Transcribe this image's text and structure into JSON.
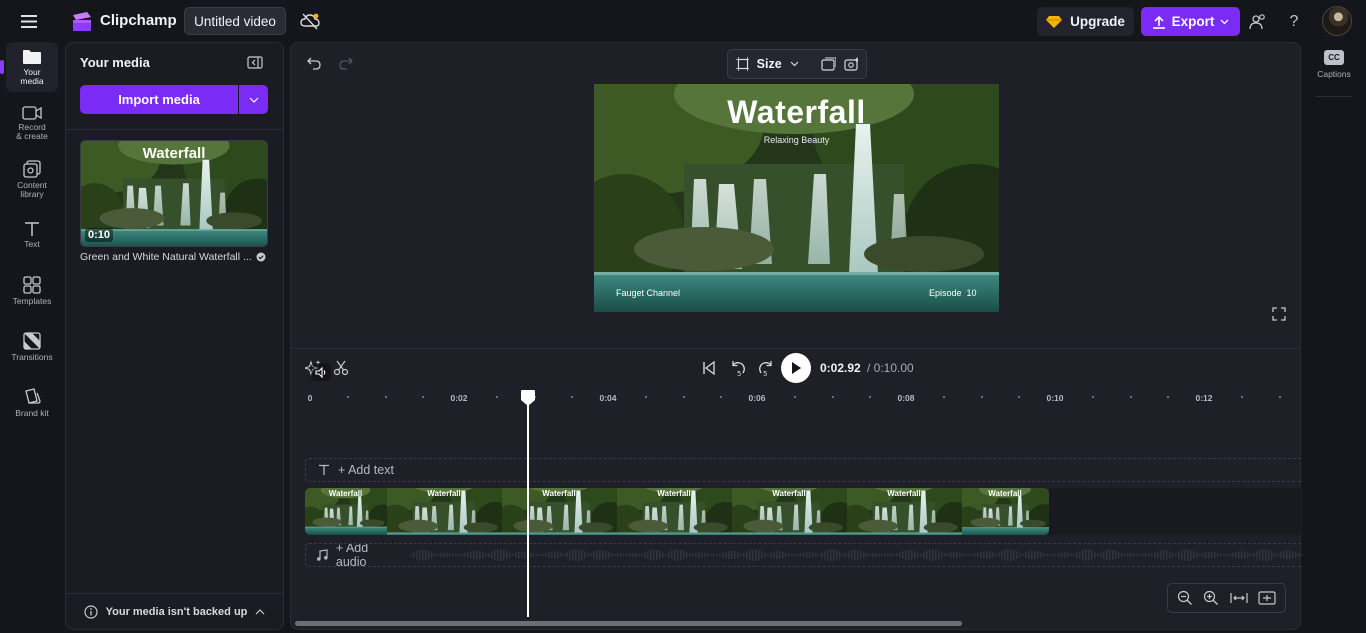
{
  "header": {
    "app_name": "Clipchamp",
    "project_title": "Untitled video",
    "upgrade_label": "Upgrade",
    "export_label": "Export",
    "help_label": "?",
    "accent_color": "#7a2bf5"
  },
  "rail": {
    "items": [
      {
        "label": "Your media",
        "icon": "folder-icon"
      },
      {
        "label": "Record & create",
        "icon": "camera-icon"
      },
      {
        "label": "Content library",
        "icon": "library-icon"
      },
      {
        "label": "Text",
        "icon": "text-icon"
      },
      {
        "label": "Templates",
        "icon": "templates-icon"
      },
      {
        "label": "Transitions",
        "icon": "transitions-icon"
      },
      {
        "label": "Brand kit",
        "icon": "brand-kit-icon"
      }
    ]
  },
  "media_panel": {
    "title": "Your media",
    "import_label": "Import media",
    "item": {
      "thumb_title": "Waterfall",
      "duration": "0:10",
      "name": "Green and White Natural Waterfall ..."
    },
    "backup_notice": "Your media isn't backed up"
  },
  "preview": {
    "size_label": "Size",
    "video_title": "Waterfall",
    "video_subtitle": "Relaxing Beauty",
    "channel": "Fauget Channel",
    "episode": "Episode  10"
  },
  "timeline": {
    "current_time": "0:02.92",
    "total_time": "/ 0:10.00",
    "ruler_labels": [
      "0",
      "0:02",
      "0:04",
      "0:06",
      "0:08",
      "0:10",
      "0:12"
    ],
    "add_text_label": "+ Add text",
    "add_audio_label": "+ Add audio",
    "clip_tile_title": "Waterfall",
    "playhead_seconds": 2.92
  },
  "captions": {
    "label": "Captions",
    "cc": "CC"
  }
}
